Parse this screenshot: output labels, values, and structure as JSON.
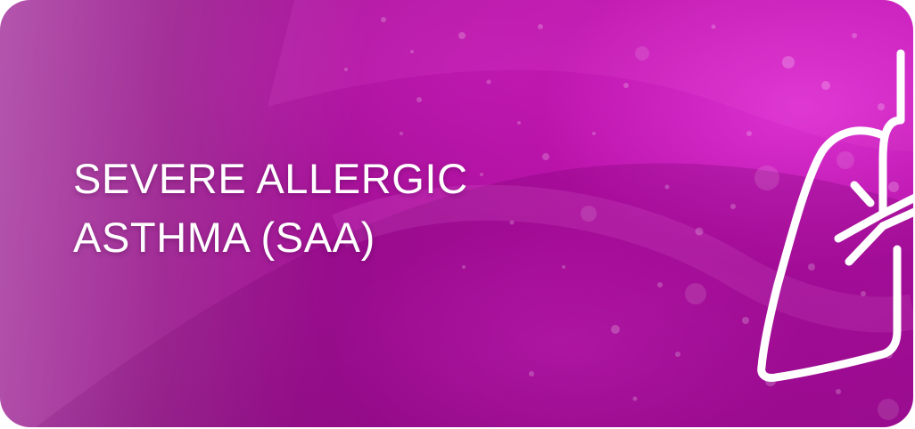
{
  "card": {
    "title_line1": "SEVERE ALLERGIC",
    "title_line2": "ASTHMA (SAA)",
    "icon": "lung-icon",
    "colors": {
      "background_primary": "#b811a8",
      "background_left": "#a3309b",
      "highlight": "#e63cdc",
      "text": "#ffffff"
    }
  }
}
